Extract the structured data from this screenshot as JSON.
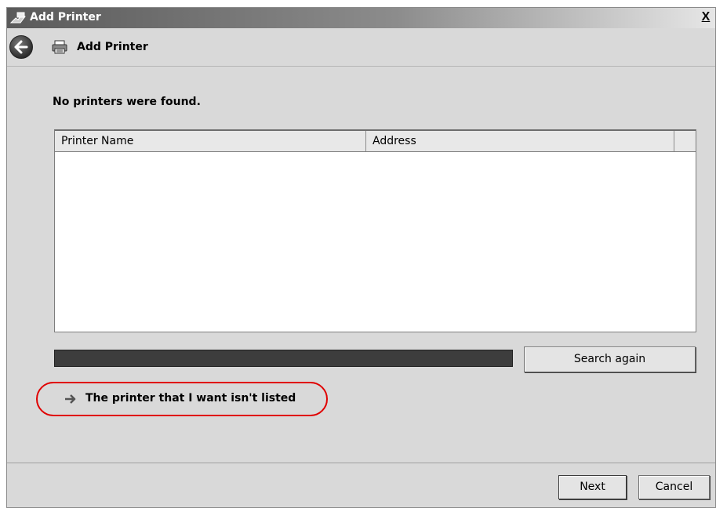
{
  "window": {
    "title": "Add Printer",
    "close_label": "X"
  },
  "nav": {
    "title": "Add Printer"
  },
  "content": {
    "heading": "No printers were found."
  },
  "list": {
    "columns": [
      "Printer Name",
      "Address",
      ""
    ]
  },
  "progress": {
    "percent": 100
  },
  "buttons": {
    "search_again": "Search again",
    "next": "Next",
    "cancel": "Cancel"
  },
  "link": {
    "label": "The printer that I want isn't listed"
  },
  "colors": {
    "highlight_ring": "#e00000",
    "progress_bar": "#3d3d3d"
  },
  "icons": {
    "title": "printer-wizard-icon",
    "back": "back-arrow-icon",
    "nav": "printer-icon",
    "link": "right-arrow-icon"
  }
}
